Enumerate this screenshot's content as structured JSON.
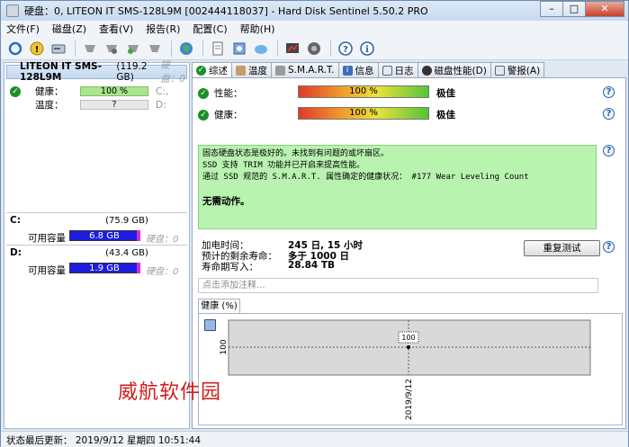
{
  "window": {
    "title": "硬盘：0, LITEON IT SMS-128L9M [002444118037]  -  Hard Disk Sentinel 5.50.2 PRO",
    "minimize": "–",
    "maximize": "□",
    "close": "✕"
  },
  "menu": [
    "文件(F)",
    "磁盘(Z)",
    "查看(V)",
    "报告(R)",
    "配置(C)",
    "帮助(H)"
  ],
  "toolbar_icons": [
    "refresh-icon",
    "warning-icon",
    "disk-icon",
    "disk-gray-1-icon",
    "disk-gray-2-icon",
    "disk-gray-3-icon",
    "disk-gray-4-icon",
    "globe-icon",
    "document-icon",
    "sync-icon",
    "cloud-icon",
    "chart-icon",
    "speaker-icon",
    "help-icon",
    "info-icon"
  ],
  "disk": {
    "name": "LITEON IT SMS-128L9M",
    "size": "(119.2 GB)",
    "handle": "硬盘：0",
    "health_label": "健康：",
    "health_value": "100 %",
    "health_drive": "C:,",
    "temp_label": "温度：",
    "temp_value": "?",
    "temp_drive": "D:"
  },
  "drives": [
    {
      "letter": "C:",
      "capacity": "(75.9 GB)",
      "free_label": "可用容量",
      "free": "6.8 GB",
      "handle": "硬盘：0",
      "free_fraction": 0.09
    },
    {
      "letter": "D:",
      "capacity": "(43.4 GB)",
      "free_label": "可用容量",
      "free": "1.9 GB",
      "handle": "硬盘：0",
      "free_fraction": 0.04
    }
  ],
  "tabs": [
    "综述",
    "温度",
    "S.M.A.R.T.",
    "信息",
    "日志",
    "磁盘性能(D)",
    "警报(A)"
  ],
  "summary": {
    "performance_label": "性能：",
    "performance_value": "100 %",
    "performance_rating": "极佳",
    "health_label": "健康：",
    "health_value": "100 %",
    "health_rating": "极佳",
    "messages": [
      "固态硬盘状态是极好的。未找到有问题的或坏扇区。",
      "SSD 支持 TRIM 功能并已开启来提高性能。",
      "通过 SSD 规范的 S.M.A.R.T. 属性确定的健康状况：   #177 Wear Leveling Count"
    ],
    "action": "无需动作。",
    "power_on_label": "加电时间：",
    "power_on_value": "245 日, 15 小时",
    "remaining_label": "预计的剩余寿命：",
    "remaining_value": "多于 1000 日",
    "written_label": "寿命期写入：",
    "written_value": "28.84 TB",
    "repeat_test": "重复测试",
    "note_placeholder": "点击添加注释..."
  },
  "chart_data": {
    "type": "line",
    "title": "健康 (%)",
    "x": [
      "2019/9/12"
    ],
    "series": [
      {
        "values": [
          100
        ]
      }
    ],
    "ytick": "100",
    "data_label": "100"
  },
  "watermark": "威航软件园",
  "status": "状态最后更新：  2019/9/12 星期四 10:51:44"
}
